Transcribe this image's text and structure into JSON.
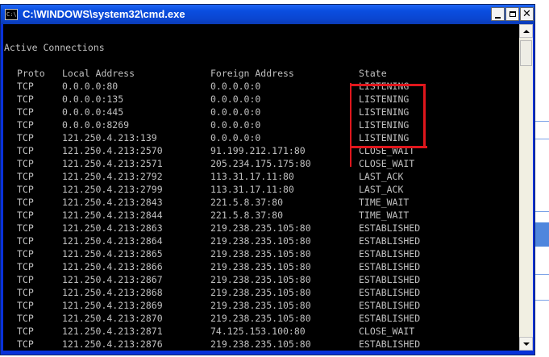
{
  "window": {
    "title": "C:\\WINDOWS\\system32\\cmd.exe",
    "icon": "cmd-icon",
    "icon_text": "C:\\"
  },
  "console": {
    "heading": "Active Connections",
    "columns": {
      "proto": "Proto",
      "local": "Local Address",
      "foreign": "Foreign Address",
      "state": "State"
    },
    "rows": [
      {
        "proto": "TCP",
        "local": "0.0.0.0:80",
        "foreign": "0.0.0.0:0",
        "state": "LISTENING"
      },
      {
        "proto": "TCP",
        "local": "0.0.0.0:135",
        "foreign": "0.0.0.0:0",
        "state": "LISTENING"
      },
      {
        "proto": "TCP",
        "local": "0.0.0.0:445",
        "foreign": "0.0.0.0:0",
        "state": "LISTENING"
      },
      {
        "proto": "TCP",
        "local": "0.0.0.0:8269",
        "foreign": "0.0.0.0:0",
        "state": "LISTENING"
      },
      {
        "proto": "TCP",
        "local": "121.250.4.213:139",
        "foreign": "0.0.0.0:0",
        "state": "LISTENING"
      },
      {
        "proto": "TCP",
        "local": "121.250.4.213:2570",
        "foreign": "91.199.212.171:80",
        "state": "CLOSE_WAIT"
      },
      {
        "proto": "TCP",
        "local": "121.250.4.213:2571",
        "foreign": "205.234.175.175:80",
        "state": "CLOSE_WAIT"
      },
      {
        "proto": "TCP",
        "local": "121.250.4.213:2792",
        "foreign": "113.31.17.11:80",
        "state": "LAST_ACK"
      },
      {
        "proto": "TCP",
        "local": "121.250.4.213:2799",
        "foreign": "113.31.17.11:80",
        "state": "LAST_ACK"
      },
      {
        "proto": "TCP",
        "local": "121.250.4.213:2843",
        "foreign": "221.5.8.37:80",
        "state": "TIME_WAIT"
      },
      {
        "proto": "TCP",
        "local": "121.250.4.213:2844",
        "foreign": "221.5.8.37:80",
        "state": "TIME_WAIT"
      },
      {
        "proto": "TCP",
        "local": "121.250.4.213:2863",
        "foreign": "219.238.235.105:80",
        "state": "ESTABLISHED"
      },
      {
        "proto": "TCP",
        "local": "121.250.4.213:2864",
        "foreign": "219.238.235.105:80",
        "state": "ESTABLISHED"
      },
      {
        "proto": "TCP",
        "local": "121.250.4.213:2865",
        "foreign": "219.238.235.105:80",
        "state": "ESTABLISHED"
      },
      {
        "proto": "TCP",
        "local": "121.250.4.213:2866",
        "foreign": "219.238.235.105:80",
        "state": "ESTABLISHED"
      },
      {
        "proto": "TCP",
        "local": "121.250.4.213:2867",
        "foreign": "219.238.235.105:80",
        "state": "ESTABLISHED"
      },
      {
        "proto": "TCP",
        "local": "121.250.4.213:2868",
        "foreign": "219.238.235.105:80",
        "state": "ESTABLISHED"
      },
      {
        "proto": "TCP",
        "local": "121.250.4.213:2869",
        "foreign": "219.238.235.105:80",
        "state": "ESTABLISHED"
      },
      {
        "proto": "TCP",
        "local": "121.250.4.213:2870",
        "foreign": "219.238.235.105:80",
        "state": "ESTABLISHED"
      },
      {
        "proto": "TCP",
        "local": "121.250.4.213:2871",
        "foreign": "74.125.153.100:80",
        "state": "CLOSE_WAIT"
      },
      {
        "proto": "TCP",
        "local": "121.250.4.213:2876",
        "foreign": "219.238.235.105:80",
        "state": "ESTABLISHED"
      }
    ]
  },
  "colors": {
    "console_bg": "#000000",
    "console_text": "#c0c0c0",
    "titlebar": "#0a4ee0",
    "annotation": "#e0161c"
  },
  "icons": [
    "cmd-icon",
    "minimize-icon",
    "maximize-icon",
    "close-icon",
    "scroll-up-arrow-icon",
    "scroll-down-arrow-icon"
  ]
}
